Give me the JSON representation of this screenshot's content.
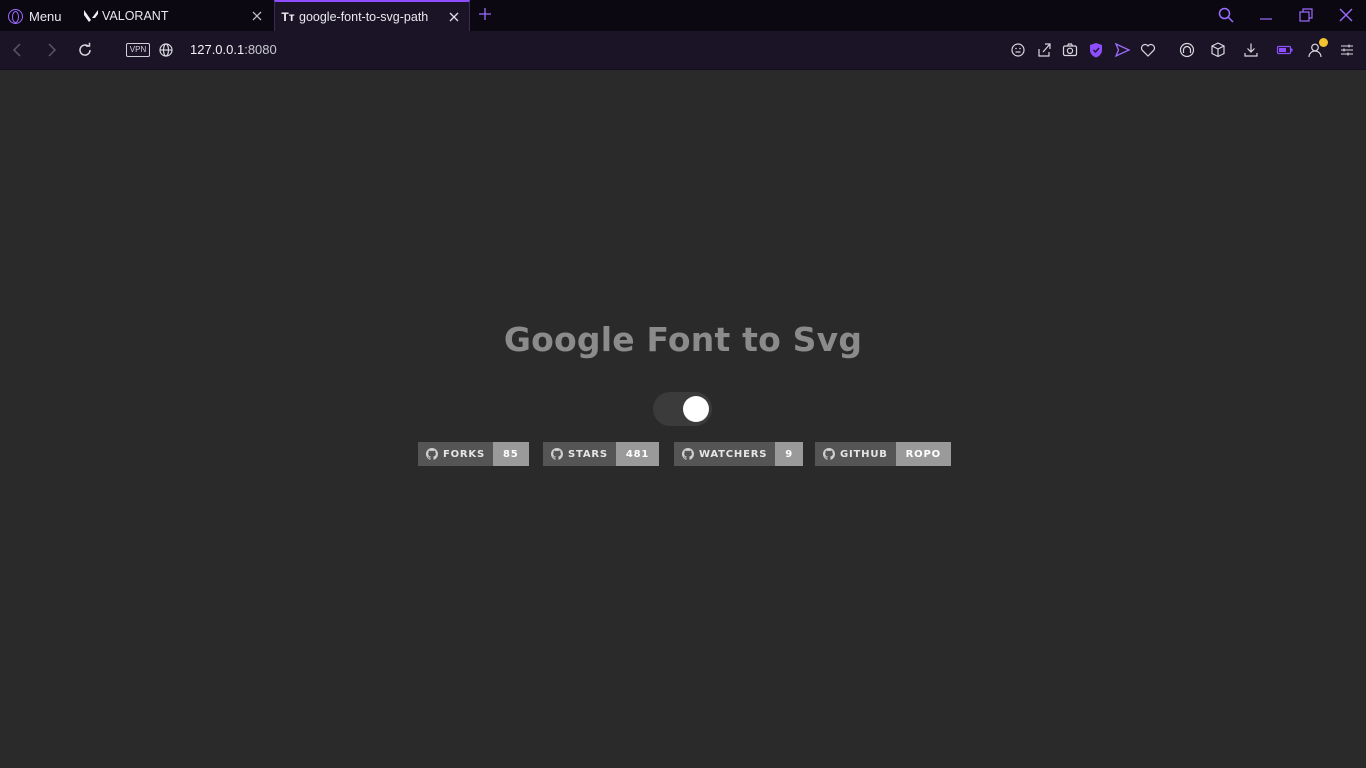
{
  "browser": {
    "menu_label": "Menu",
    "tabs": [
      {
        "title": "VALORANT",
        "icon": "valorant-icon"
      },
      {
        "title": "google-font-to-svg-path",
        "icon": "text-size-icon",
        "favicon_text": "Tт"
      }
    ],
    "vpn_label": "VPN",
    "url_host": "127.0.0.1",
    "url_port": ":8080",
    "accent_color": "#8e4dff"
  },
  "page": {
    "title": "Google Font to Svg",
    "toggle_on": true,
    "shields": [
      {
        "label": "FORKS",
        "value": "85"
      },
      {
        "label": "STARS",
        "value": "481"
      },
      {
        "label": "WATCHERS",
        "value": "9"
      },
      {
        "label": "GITHUB",
        "value": "ROPO"
      }
    ]
  }
}
